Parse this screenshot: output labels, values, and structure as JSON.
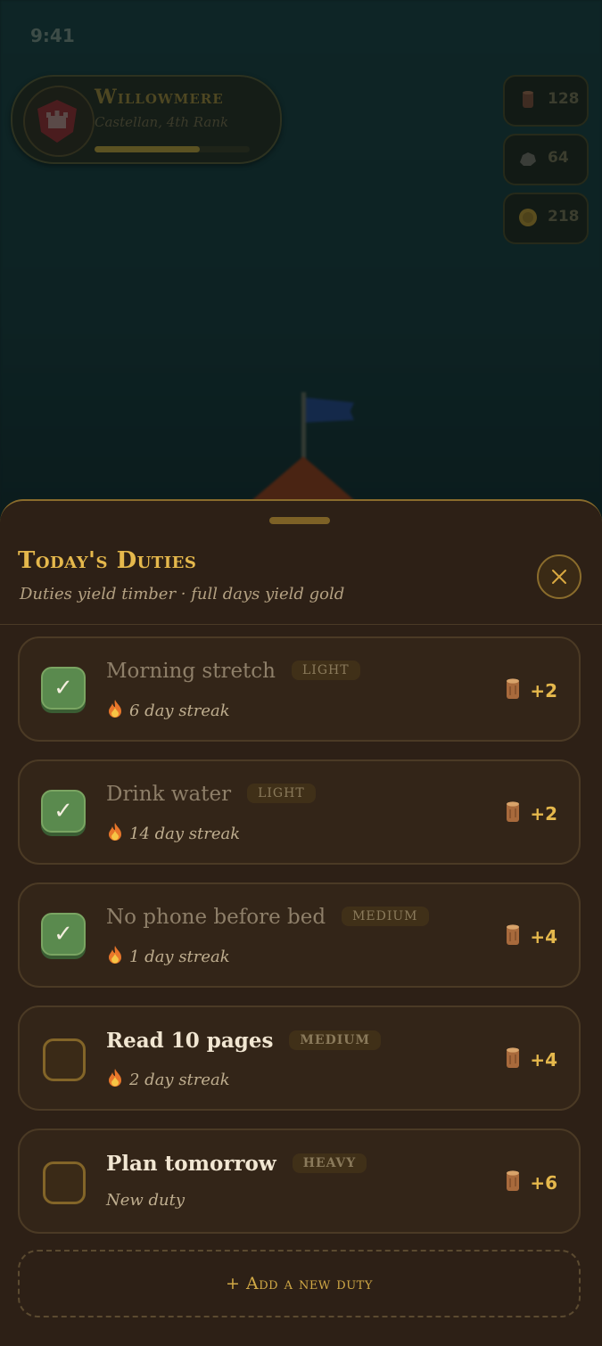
{
  "status_bar": {
    "time": "9:41"
  },
  "realm": {
    "name": "Willowmere",
    "subtitle": "Castellan, 4th Rank",
    "progress_fraction": 0.68,
    "crest_icon": "castle-crest-icon"
  },
  "resources": [
    {
      "icon": "timber-log-icon",
      "value": "128"
    },
    {
      "icon": "stone-icon",
      "value": "64"
    },
    {
      "icon": "gold-coin-icon",
      "value": "218"
    }
  ],
  "sheet": {
    "title": "Today's Duties",
    "subtitle": "Duties yield timber · full days yield gold",
    "close_icon": "close-icon"
  },
  "duties": [
    {
      "name": "Morning stretch",
      "tag": "LIGHT",
      "meta": "6 day streak",
      "streak_icon": "flame-icon",
      "reward": "+2",
      "done": true
    },
    {
      "name": "Drink water",
      "tag": "LIGHT",
      "meta": "14 day streak",
      "streak_icon": "flame-icon",
      "reward": "+2",
      "done": true
    },
    {
      "name": "No phone before bed",
      "tag": "MEDIUM",
      "meta": "1 day streak",
      "streak_icon": "flame-icon",
      "reward": "+4",
      "done": true
    },
    {
      "name": "Read 10 pages",
      "tag": "MEDIUM",
      "meta": "2 day streak",
      "streak_icon": "flame-icon",
      "reward": "+4",
      "done": false
    },
    {
      "name": "Plan tomorrow",
      "tag": "HEAVY",
      "meta": "New duty",
      "streak_icon": "",
      "reward": "+6",
      "done": false
    }
  ],
  "check_symbol": "✓",
  "add_duty_label": "+ Add a new duty",
  "colors": {
    "accent_gold": "#e5b84c",
    "sheet_bg": "#2d2016",
    "done_green": "#5a8a4e"
  }
}
